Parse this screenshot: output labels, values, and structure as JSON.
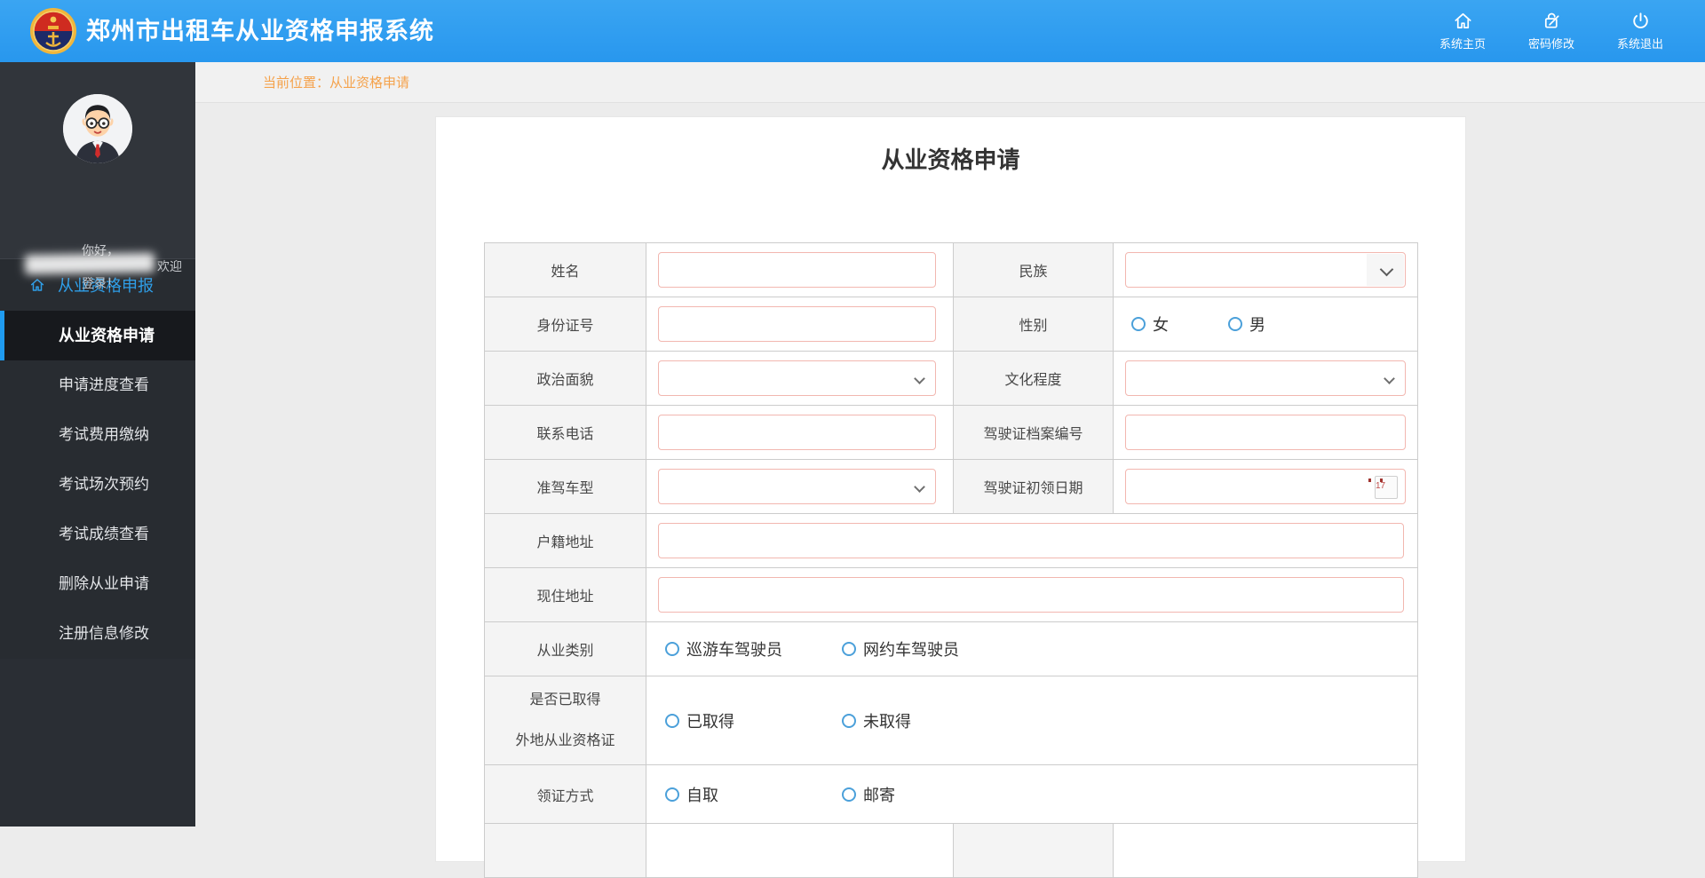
{
  "header": {
    "title": "郑州市出租车从业资格申报系统",
    "nav_items": [
      "系统主页",
      "密码修改",
      "系统退出"
    ]
  },
  "sidebar": {
    "greeting_line1": "你好，",
    "greeting_line2": "欢迎",
    "greeting_line3": "登录！",
    "group_label": "从业资格申报",
    "items": [
      "从业资格申请",
      "申请进度查看",
      "考试费用缴纳",
      "考试场次预约",
      "考试成绩查看",
      "删除从业申请",
      "注册信息修改"
    ],
    "active_item": "从业资格申请"
  },
  "breadcrumb": "当前位置：从业资格申请",
  "form": {
    "title": "从业资格申请",
    "fields": {
      "name_label": "姓名",
      "ethnicity_label": "民族",
      "id_number_label": "身份证号",
      "gender_label": "性别",
      "gender_options": [
        "女",
        "男"
      ],
      "political_label": "政治面貌",
      "education_label": "文化程度",
      "phone_label": "联系电话",
      "license_file_label": "驾驶证档案编号",
      "license_class_label": "准驾车型",
      "license_date_label": "驾驶证初领日期",
      "calendar_icon_day": "17",
      "household_label": "户籍地址",
      "residence_label": "现住地址",
      "category_label": "从业类别",
      "category_options": [
        "巡游车驾驶员",
        "网约车驾驶员"
      ],
      "foreign_cert_label_line1": "是否已取得",
      "foreign_cert_label_line2": "外地从业资格证",
      "foreign_cert_options": [
        "已取得",
        "未取得"
      ],
      "delivery_label": "领证方式",
      "delivery_options": [
        "自取",
        "邮寄"
      ]
    }
  },
  "colors": {
    "header_blue": "#2e9df0",
    "accent_blue": "#1f9bf0",
    "sidebar_dark": "#2a2e34",
    "breadcrumb_orange": "#f5a24b",
    "input_border_pink": "#f2b7b0",
    "radio_blue": "#4ba0da",
    "emblem_red": "#cf2b20",
    "emblem_navy": "#1d2a68",
    "emblem_gold": "#f0b63c"
  }
}
